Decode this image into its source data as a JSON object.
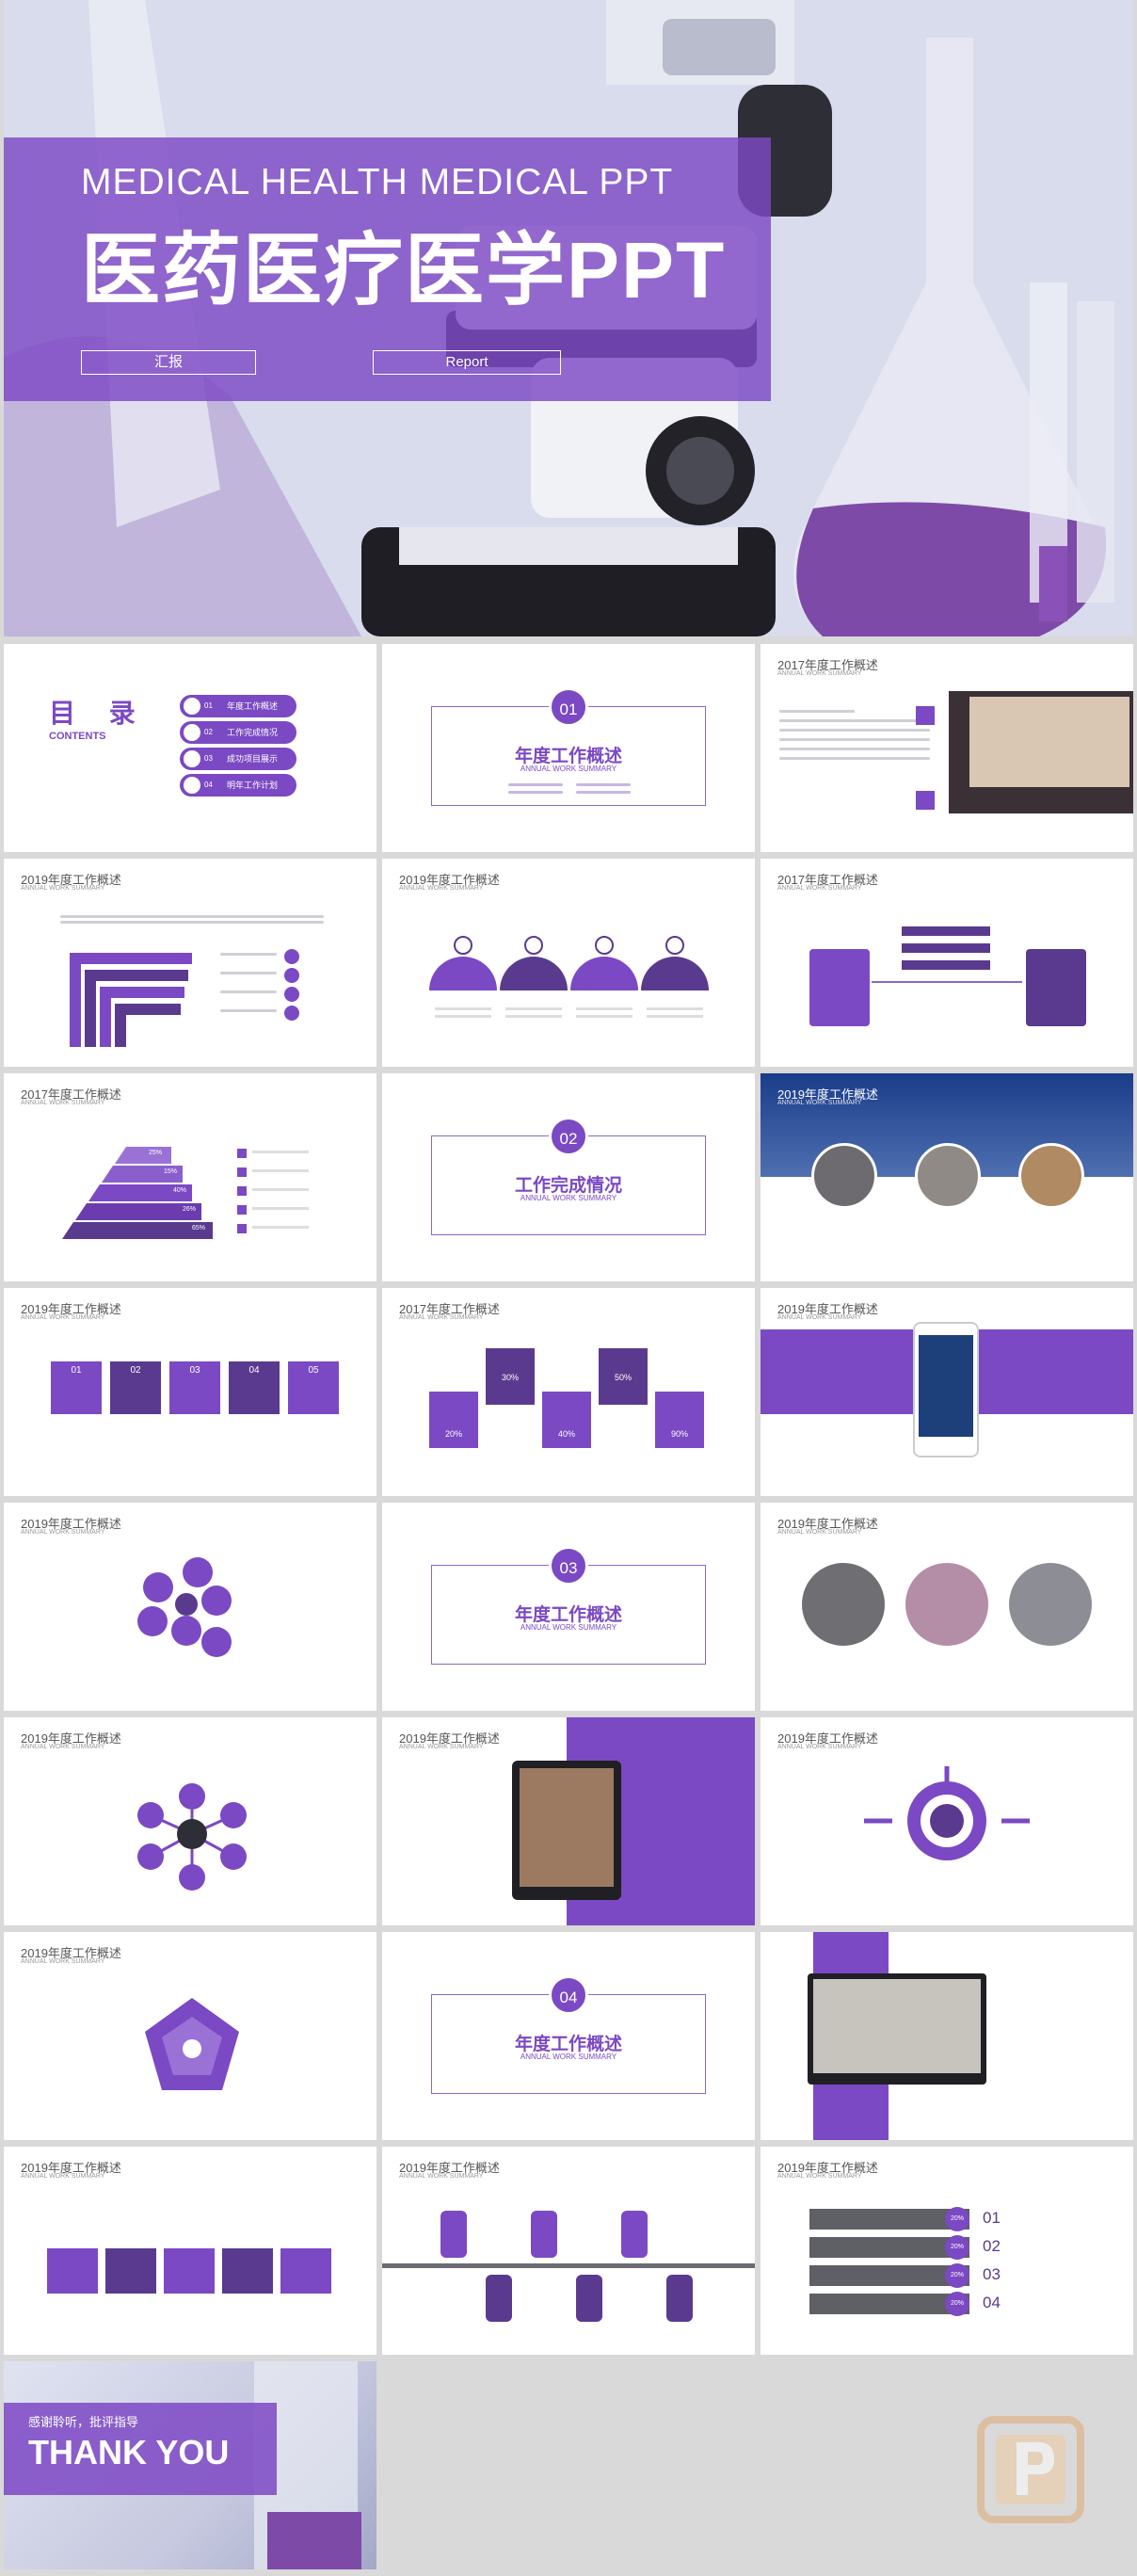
{
  "cover": {
    "subtitle_en": "MEDICAL HEALTH MEDICAL PPT",
    "title_cn": "医药医疗医学PPT",
    "button1": "汇报",
    "button2": "Report"
  },
  "contents": {
    "title": "目 录",
    "subtitle": "CONTENTS",
    "items": [
      {
        "num": "01",
        "label": "年度工作概述"
      },
      {
        "num": "02",
        "label": "工作完成情况"
      },
      {
        "num": "03",
        "label": "成功项目展示"
      },
      {
        "num": "04",
        "label": "明年工作计划"
      }
    ]
  },
  "sections": [
    {
      "num": "01",
      "title": "年度工作概述",
      "sub": "ANNUAL WORK SUMMARY"
    },
    {
      "num": "02",
      "title": "工作完成情况",
      "sub": "ANNUAL WORK SUMMARY"
    },
    {
      "num": "03",
      "title": "年度工作概述",
      "sub": "ANNUAL WORK SUMMARY"
    },
    {
      "num": "04",
      "title": "年度工作概述",
      "sub": "ANNUAL WORK SUMMARY"
    }
  ],
  "slide_titles": {
    "t2017": "2017年度工作概述",
    "t2019": "2019年度工作概述",
    "sub": "ANNUAL WORK SUMMARY"
  },
  "percent_pyramid": [
    "25%",
    "15%",
    "40%",
    "26%",
    "65%"
  ],
  "hex_percents": [
    "20%",
    "30%",
    "40%",
    "50%",
    "90%"
  ],
  "banner_nums": [
    "01",
    "02",
    "03",
    "04",
    "05"
  ],
  "list_nums": [
    "01",
    "02",
    "03",
    "04"
  ],
  "bar_percents": [
    "20%",
    "20%",
    "20%",
    "20%"
  ],
  "thanks": {
    "line1": "感谢聆听，批评指导",
    "line2": "THANK YOU"
  },
  "colors": {
    "accent": "#7b49c3",
    "accent_dark": "#5a3a8e",
    "background": "#d9d9d9"
  }
}
